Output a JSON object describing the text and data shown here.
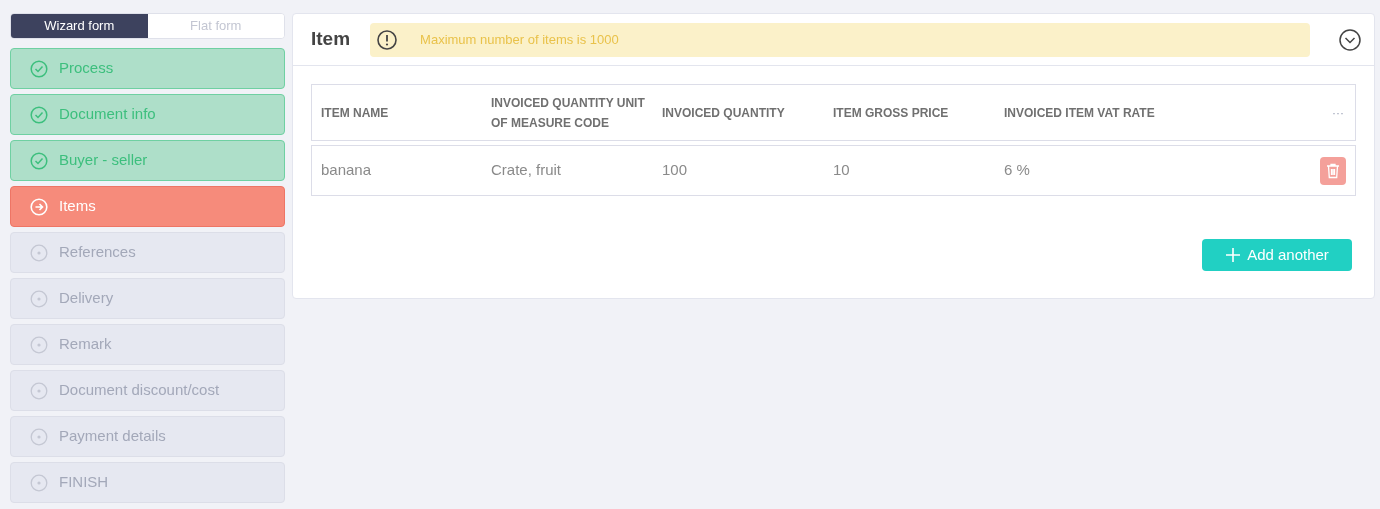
{
  "mode_tabs": [
    {
      "label": "Wizard form",
      "selected": true
    },
    {
      "label": "Flat form",
      "selected": false
    }
  ],
  "steps": [
    {
      "label": "Process",
      "completed": true,
      "current": false
    },
    {
      "label": "Document info",
      "completed": true,
      "current": false
    },
    {
      "label": "Buyer - seller",
      "completed": true,
      "current": false
    },
    {
      "label": "Items",
      "completed": false,
      "current": true
    },
    {
      "label": "References",
      "completed": false,
      "current": false
    },
    {
      "label": "Delivery",
      "completed": false,
      "current": false
    },
    {
      "label": "Remark",
      "completed": false,
      "current": false
    },
    {
      "label": "Document discount/cost",
      "completed": false,
      "current": false
    },
    {
      "label": "Payment details",
      "completed": false,
      "current": false
    },
    {
      "label": "FINISH",
      "completed": false,
      "current": false
    }
  ],
  "panel": {
    "title": "Item",
    "notice": "Maximum number of items is 1000",
    "table": {
      "columns": [
        "ITEM NAME",
        "INVOICED QUANTITY UNIT OF MEASURE CODE",
        "INVOICED QUANTITY",
        "ITEM GROSS PRICE",
        "INVOICED ITEM VAT RATE"
      ],
      "menu": "···",
      "rows": [
        [
          "banana",
          "Crate, fruit",
          "100",
          "10",
          "6 %"
        ]
      ]
    },
    "add_button": "Add another"
  }
}
